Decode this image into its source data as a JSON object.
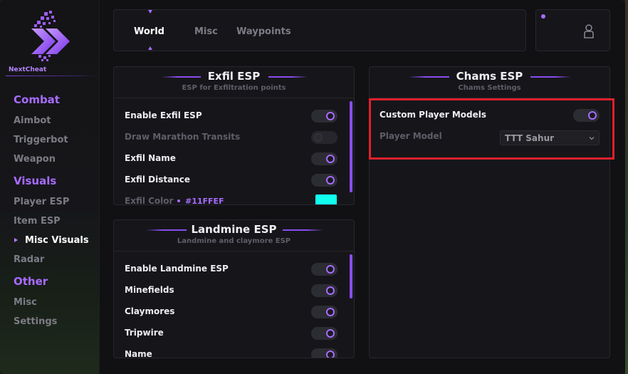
{
  "brand": {
    "name": "NextCheat"
  },
  "colors": {
    "accent": "#a86cff",
    "highlight": "#e2202c",
    "exfil_color": "#11FFEF"
  },
  "sidebar": {
    "categories": [
      {
        "label": "Combat",
        "items": [
          "Aimbot",
          "Triggerbot",
          "Weapon"
        ]
      },
      {
        "label": "Visuals",
        "items": [
          "Player ESP",
          "Item ESP",
          "Misc Visuals",
          "Radar"
        ]
      },
      {
        "label": "Other",
        "items": [
          "Misc",
          "Settings"
        ]
      }
    ],
    "active_item": "Misc Visuals"
  },
  "tabs": [
    {
      "label": "World",
      "active": true
    },
    {
      "label": "Misc",
      "active": false
    },
    {
      "label": "Waypoints",
      "active": false
    }
  ],
  "user": {
    "icon": "user-icon"
  },
  "panels": {
    "exfil": {
      "title": "Exfil ESP",
      "subtitle": "ESP for Exfiltration points",
      "rows": [
        {
          "label": "Enable Exfil ESP",
          "on": true,
          "enabled": true
        },
        {
          "label": "Draw Marathon Transits",
          "on": false,
          "enabled": false
        },
        {
          "label": "Exfil Name",
          "on": true,
          "enabled": true
        },
        {
          "label": "Exfil Distance",
          "on": true,
          "enabled": true
        },
        {
          "label": "Exfil Color",
          "value": "#11FFEF",
          "enabled": false
        }
      ]
    },
    "landmine": {
      "title": "Landmine ESP",
      "subtitle": "Landmine and claymore ESP",
      "rows": [
        {
          "label": "Enable Landmine ESP",
          "on": true
        },
        {
          "label": "Minefields",
          "on": true
        },
        {
          "label": "Claymores",
          "on": true
        },
        {
          "label": "Tripwire",
          "on": true
        },
        {
          "label": "Name",
          "on": true
        }
      ]
    },
    "chams": {
      "title": "Chams ESP",
      "subtitle": "Chams Settings",
      "rows": [
        {
          "label": "Custom Player Models",
          "on": true
        },
        {
          "label": "Player Model",
          "value": "TTT Sahur",
          "options_visible": [
            "TTT Sahur"
          ]
        }
      ]
    }
  }
}
